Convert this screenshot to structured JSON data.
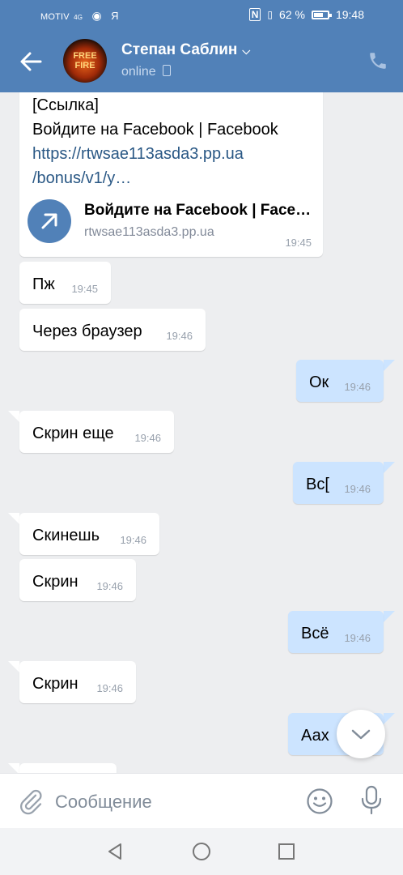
{
  "statusbar": {
    "carrier": "MOTIV",
    "net": "4G",
    "ya": "Я",
    "battery": "62 %",
    "time": "19:48"
  },
  "header": {
    "contact_name": "Степан Саблин",
    "status": "online",
    "avatar_text": [
      "FREE",
      "FIRE"
    ]
  },
  "link_message": {
    "lines": [
      "[Ссылка]",
      "Войдите на Facebook | Facebook",
      "https://rtwsae113asda3.pp.ua",
      "/bonus/v1/y…"
    ],
    "attachment_title": "Войдите на Facebook | Face…",
    "attachment_domain": "rtwsae113asda3.pp.ua",
    "time": "19:45"
  },
  "messages": [
    {
      "dir": "in",
      "text": "Пж",
      "time": "19:45"
    },
    {
      "dir": "in",
      "text": "Через браузер",
      "time": "19:46"
    },
    {
      "dir": "out",
      "text": "Ок",
      "time": "19:46"
    },
    {
      "dir": "in",
      "text": "Скрин еще",
      "time": "19:46"
    },
    {
      "dir": "out",
      "text": "Вс[",
      "time": "19:46"
    },
    {
      "dir": "in",
      "text": "Скинешь",
      "time": "19:46"
    },
    {
      "dir": "in",
      "text": "Скрин",
      "time": "19:46"
    },
    {
      "dir": "out",
      "text": "Всё",
      "time": "19:46"
    },
    {
      "dir": "in",
      "text": "Скрин",
      "time": "19:46"
    },
    {
      "dir": "out",
      "text": "Аах",
      "time": ""
    }
  ],
  "composer": {
    "placeholder": "Сообщение",
    "value": ""
  },
  "colors": {
    "header": "#5181b8",
    "incoming": "#ffffff",
    "outgoing": "#cce4ff",
    "background": "#edeef0",
    "link": "#2a5885"
  }
}
